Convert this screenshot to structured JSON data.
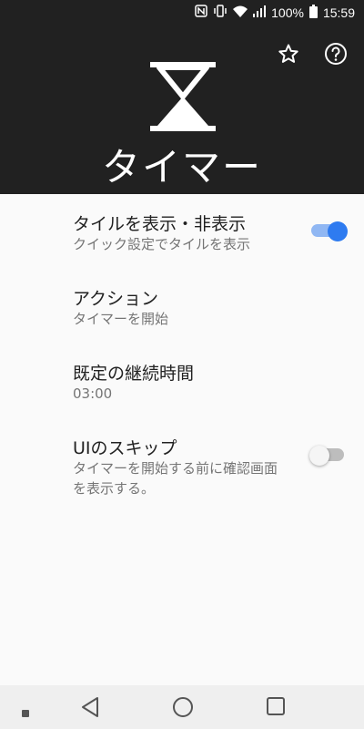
{
  "status_bar": {
    "battery_percent": "100%",
    "time": "15:59"
  },
  "header": {
    "title": "タイマー"
  },
  "settings": {
    "show_tile": {
      "title": "タイルを表示・非表示",
      "subtitle": "クイック設定でタイルを表示",
      "enabled": true
    },
    "action": {
      "title": "アクション",
      "subtitle": "タイマーを開始"
    },
    "default_duration": {
      "title": "既定の継続時間",
      "value": "03:00"
    },
    "skip_ui": {
      "title": "UIのスキップ",
      "subtitle": "タイマーを開始する前に確認画面を表示する。",
      "enabled": false
    }
  },
  "colors": {
    "header_bg": "#212121",
    "accent": "#2e7bf0"
  }
}
